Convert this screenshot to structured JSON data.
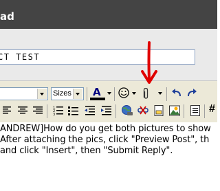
{
  "window": {
    "title_fragment": "ad"
  },
  "subject": {
    "value": "CT TEST"
  },
  "toolbar": {
    "size_label": "Sizes",
    "font_color_icon": "font-color-icon",
    "smiley_icon": "smiley-icon",
    "attach_icon": "paperclip-icon"
  },
  "editor": {
    "lines": [
      "ANDREW]How do you get both pictures to show",
      "After attaching the pics, click \"Preview Post\", th",
      " and click \"Insert\", then \"Submit Reply\"."
    ]
  },
  "colors": {
    "title_bar": "#444444",
    "toolbar": "#ece9d8",
    "annotation_arrow": "#e00000",
    "link_blue": "#1f3f99"
  }
}
